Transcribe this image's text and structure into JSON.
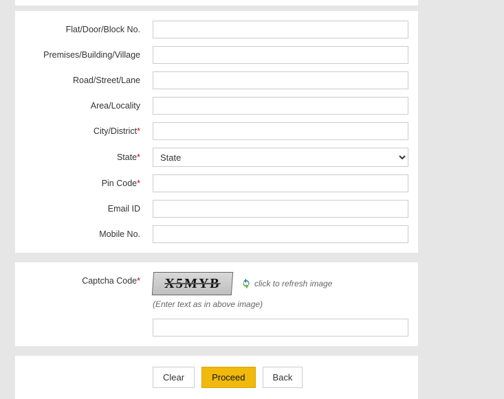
{
  "fields": {
    "flat": {
      "label": "Flat/Door/Block No.",
      "required": false
    },
    "premises": {
      "label": "Premises/Building/Village",
      "required": false
    },
    "road": {
      "label": "Road/Street/Lane",
      "required": false
    },
    "area": {
      "label": "Area/Locality",
      "required": false
    },
    "city": {
      "label": "City/District",
      "required": true
    },
    "state": {
      "label": "State",
      "required": true,
      "selected": "State"
    },
    "pin": {
      "label": "Pin Code",
      "required": true
    },
    "email": {
      "label": "Email ID",
      "required": false
    },
    "mobile": {
      "label": "Mobile No.",
      "required": false
    }
  },
  "captcha": {
    "label": "Captcha Code",
    "required": true,
    "image_text": "X5MYB",
    "refresh_text": "click to refresh image",
    "hint": "(Enter text as in above image)"
  },
  "buttons": {
    "clear": "Clear",
    "proceed": "Proceed",
    "back": "Back"
  },
  "required_marker": "*"
}
